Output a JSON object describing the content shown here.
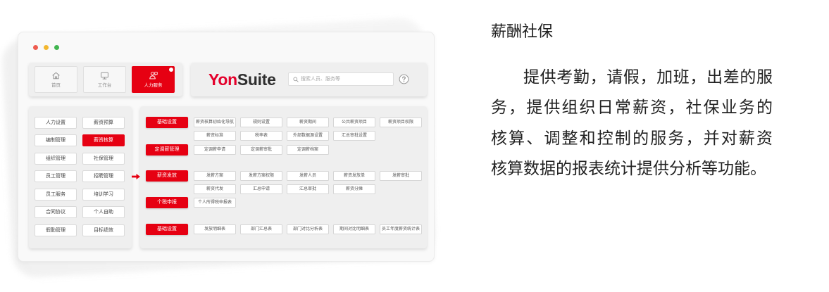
{
  "colors": {
    "accent": "#e60012",
    "brand_red": "#e4002b",
    "brand_dark": "#2e2e2e",
    "dot_red": "#ee5c50",
    "dot_yellow": "#f3b72f",
    "dot_green": "#41b550",
    "text": "#222222"
  },
  "nav": {
    "tiles": [
      {
        "label": "首页",
        "icon": "home-icon",
        "active": false,
        "badge": false
      },
      {
        "label": "工作台",
        "icon": "monitor-icon",
        "active": false,
        "badge": false
      },
      {
        "label": "人力服务",
        "icon": "people-icon",
        "active": true,
        "badge": true
      }
    ]
  },
  "header": {
    "brand_prefix": "Yon",
    "brand_suffix": "Suite",
    "search_placeholder": "搜索人员、服务等",
    "search_icon": "search-icon",
    "help_icon": "help-icon"
  },
  "modules": [
    {
      "label": "人力设置",
      "active": false
    },
    {
      "label": "薪资预算",
      "active": false
    },
    {
      "label": "编制管理",
      "active": false
    },
    {
      "label": "薪资核算",
      "active": true
    },
    {
      "label": "组织管理",
      "active": false
    },
    {
      "label": "社保管理",
      "active": false
    },
    {
      "label": "员工管理",
      "active": false
    },
    {
      "label": "招聘管理",
      "active": false
    },
    {
      "label": "员工服务",
      "active": false
    },
    {
      "label": "培训学习",
      "active": false
    },
    {
      "label": "合同协议",
      "active": false
    },
    {
      "label": "个人自助",
      "active": false
    },
    {
      "label": "假勤管理",
      "active": false
    },
    {
      "label": "目标绩效",
      "active": false
    }
  ],
  "arrow_icon": "arrow-right-icon",
  "function_groups": [
    {
      "label": "基础设置",
      "rows": [
        [
          "薪资核算初始化导航",
          "规则设置",
          "薪资期间",
          "公共薪资项目",
          "薪资项目权限"
        ],
        [
          "薪资标准",
          "税率表",
          "外部数据源设置",
          "汇总审批设置"
        ]
      ]
    },
    {
      "label": "定调薪管理",
      "rows": [
        [
          "定调薪申请",
          "定调薪审批",
          "定调薪档案"
        ]
      ]
    },
    {
      "label": "薪资发放",
      "rows": [
        [
          "发薪方案",
          "发薪方案权限",
          "发薪人员",
          "薪资发放单",
          "发薪审批"
        ],
        [
          "薪资代发",
          "汇总申请",
          "汇总审批",
          "薪资分摊"
        ]
      ]
    },
    {
      "label": "个税申报",
      "rows": [
        [
          "个人所得税申报表"
        ]
      ]
    },
    {
      "label": "基础设置",
      "rows": [
        [
          "发放明细表",
          "部门汇总表",
          "部门对比分析表",
          "期间对比明细表",
          "员工年度薪资统计表"
        ]
      ]
    }
  ],
  "info": {
    "title": "薪酬社保",
    "paragraph_lines": [
      "提供考勤，请假，加班，出差的服",
      "务，提供组织日常薪资，社保业务的",
      "核算、调整和控制的服务，并对薪资",
      "核算数据的报表统计提供分析等功能。"
    ]
  }
}
